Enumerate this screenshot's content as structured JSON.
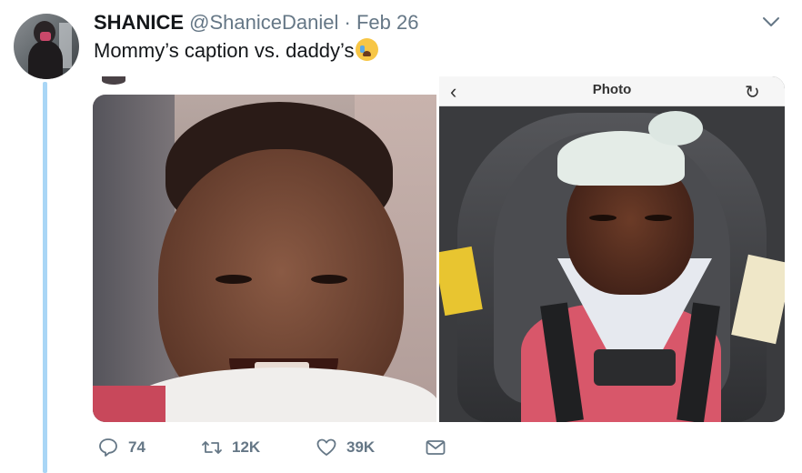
{
  "tweet": {
    "author": {
      "display_name": "SHANICE",
      "handle": "@ShaniceDaniel",
      "separator": "·",
      "date": "Feb 26"
    },
    "text": "Mommy’s caption vs. daddy’s",
    "emoji": "loudly-crying-face"
  },
  "embedded_screenshot": {
    "nav_title": "Photo",
    "back_glyph": "‹",
    "refresh_glyph": "↻"
  },
  "actions": {
    "reply_count": "74",
    "retweet_count": "12K",
    "like_count": "39K"
  },
  "colors": {
    "thread_line": "#a9d6f6",
    "secondary_text": "#657786",
    "primary_text": "#14171a"
  }
}
